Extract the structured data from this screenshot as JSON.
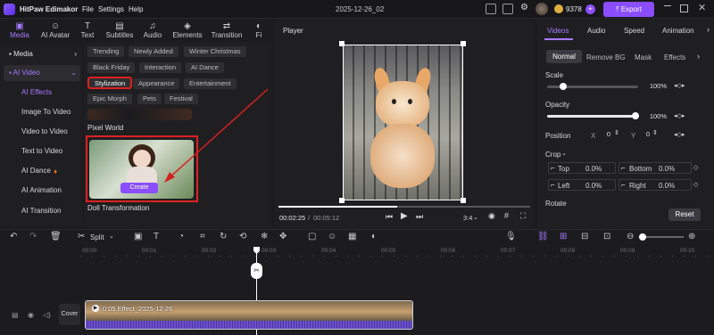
{
  "app": {
    "title": "HitPaw Edimakor",
    "menu": [
      "File",
      "Settings",
      "Help"
    ],
    "project": "2025-12-26_02",
    "credits": "9378",
    "export_label": "Export"
  },
  "left_tabs": [
    {
      "label": "Media",
      "icon": "media-icon"
    },
    {
      "label": "AI Avatar",
      "icon": "avatar-icon"
    },
    {
      "label": "Text",
      "icon": "text-icon"
    },
    {
      "label": "Subtitles",
      "icon": "subtitles-icon"
    },
    {
      "label": "Audio",
      "icon": "audio-icon"
    },
    {
      "label": "Elements",
      "icon": "elements-icon"
    },
    {
      "label": "Transition",
      "icon": "transition-icon"
    },
    {
      "label": "Fi",
      "icon": "filter-icon"
    }
  ],
  "sidebar": {
    "media": "Media",
    "ai_video": "AI Video",
    "items": [
      "AI Effects",
      "Image To Video",
      "Video to Video",
      "Text to Video",
      "AI Dance",
      "AI Animation",
      "AI Transition"
    ]
  },
  "library": {
    "chips": [
      "Trending",
      "Newly Added",
      "Winter Christmas",
      "Black Friday",
      "Interaction",
      "AI Dance",
      "Stylization",
      "Appearance",
      "Entertainment",
      "Epic Morph",
      "Pets",
      "Festival"
    ],
    "cards": [
      {
        "title": "Pixel World"
      },
      {
        "title": "Doll Transformation",
        "create_label": "Create"
      }
    ]
  },
  "player": {
    "title": "Player",
    "current_time": "00:02:25",
    "separator": "/",
    "total_time": "00:05:12",
    "aspect": "3:4",
    "progress": 0.47
  },
  "right_panel": {
    "tabs": [
      "Videos",
      "Audio",
      "Speed",
      "Animation"
    ],
    "subtabs": [
      "Normal",
      "Remove BG",
      "Mask",
      "Effects"
    ],
    "scale_label": "Scale",
    "scale_value": "100%",
    "opacity_label": "Opacity",
    "opacity_value": "100%",
    "position_label": "Position",
    "pos_x_label": "X",
    "pos_x": "0",
    "pos_y_label": "Y",
    "pos_y": "0",
    "crop_label": "Crop",
    "crop": [
      {
        "label": "Top",
        "value": "0.0%"
      },
      {
        "label": "Bottom",
        "value": "0.0%"
      },
      {
        "label": "Left",
        "value": "0.0%"
      },
      {
        "label": "Right",
        "value": "0.0%"
      }
    ],
    "rotate_label": "Rotate",
    "reset_label": "Reset"
  },
  "timeline": {
    "split_label": "Split",
    "ruler": [
      "00:00",
      "00:01",
      "00:02",
      "00:03",
      "00:04",
      "00:05",
      "00:06",
      "00:07",
      "00:08",
      "00:09",
      "00:10"
    ],
    "clip_label": "0:05 Effect_2025-12-26",
    "cover_label": "Cover"
  },
  "colors": {
    "accent": "#8b5cf6",
    "highlight": "#e02020",
    "export": "#8a4dff"
  }
}
